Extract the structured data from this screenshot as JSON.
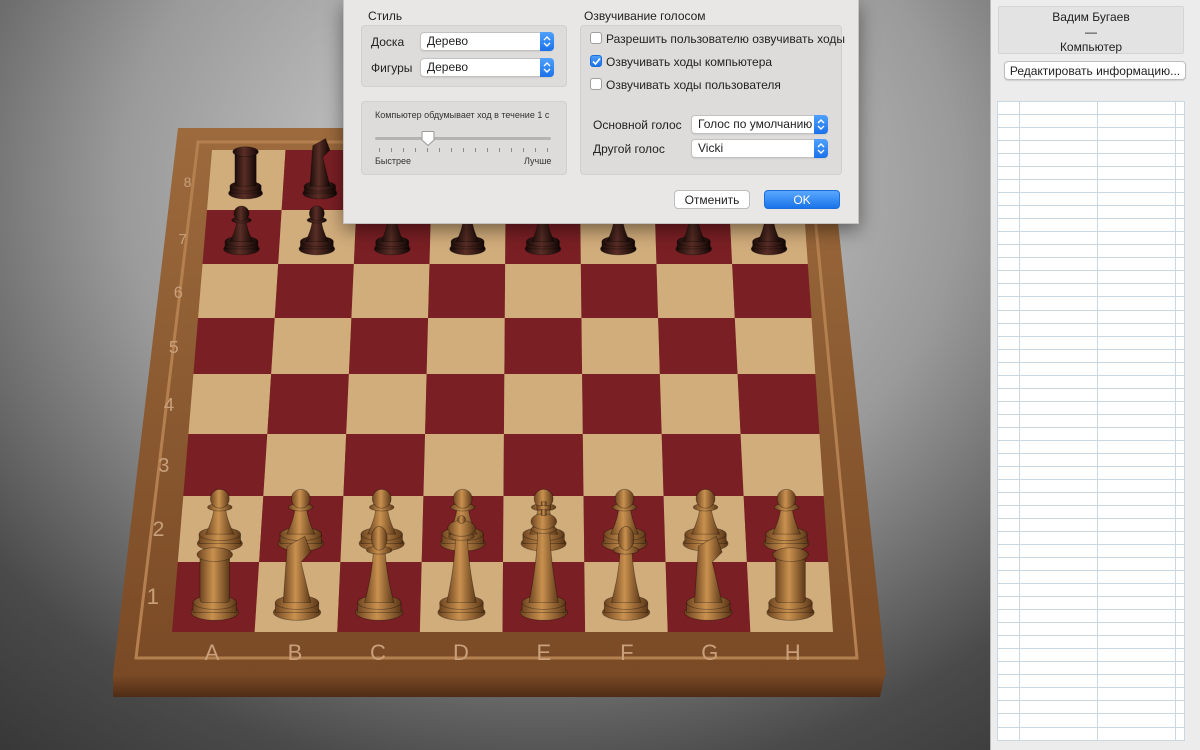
{
  "board": {
    "rank_labels": [
      "8",
      "7",
      "6",
      "5",
      "4",
      "3",
      "2",
      "1"
    ],
    "file_labels": [
      "A",
      "B",
      "C",
      "D",
      "E",
      "F",
      "G",
      "H"
    ],
    "colors": {
      "light": "#d2ad7c",
      "dark": "#7a1f24",
      "frame": "#8b5a33",
      "white_piece": "#a9743d",
      "black_piece": "#3a1d18"
    }
  },
  "pieces": [
    {
      "type": "rook",
      "color": "black",
      "square": "a8"
    },
    {
      "type": "knight",
      "color": "black",
      "square": "b8"
    },
    {
      "type": "pawn",
      "color": "black",
      "square": "a7"
    },
    {
      "type": "pawn",
      "color": "black",
      "square": "b7"
    },
    {
      "type": "pawn",
      "color": "black",
      "square": "c7"
    },
    {
      "type": "pawn",
      "color": "black",
      "square": "d7"
    },
    {
      "type": "pawn",
      "color": "black",
      "square": "e7"
    },
    {
      "type": "pawn",
      "color": "black",
      "square": "f7"
    },
    {
      "type": "pawn",
      "color": "black",
      "square": "g7"
    },
    {
      "type": "pawn",
      "color": "black",
      "square": "h7"
    },
    {
      "type": "pawn",
      "color": "white",
      "square": "a2"
    },
    {
      "type": "pawn",
      "color": "white",
      "square": "b2"
    },
    {
      "type": "pawn",
      "color": "white",
      "square": "c2"
    },
    {
      "type": "pawn",
      "color": "white",
      "square": "d2"
    },
    {
      "type": "pawn",
      "color": "white",
      "square": "e2"
    },
    {
      "type": "pawn",
      "color": "white",
      "square": "f2"
    },
    {
      "type": "pawn",
      "color": "white",
      "square": "g2"
    },
    {
      "type": "pawn",
      "color": "white",
      "square": "h2"
    },
    {
      "type": "rook",
      "color": "white",
      "square": "a1"
    },
    {
      "type": "knight",
      "color": "white",
      "square": "b1"
    },
    {
      "type": "bishop",
      "color": "white",
      "square": "c1"
    },
    {
      "type": "queen",
      "color": "white",
      "square": "d1"
    },
    {
      "type": "king",
      "color": "white",
      "square": "e1"
    },
    {
      "type": "bishop",
      "color": "white",
      "square": "f1"
    },
    {
      "type": "knight",
      "color": "white",
      "square": "g1"
    },
    {
      "type": "rook",
      "color": "white",
      "square": "h1"
    }
  ],
  "side_panel": {
    "white_player": "Вадим Бугаев",
    "separator": "—",
    "black_player": "Компьютер",
    "edit_button": "Редактировать информацию..."
  },
  "prefs": {
    "style_title": "Стиль",
    "board_label": "Доска",
    "board_value": "Дерево",
    "pieces_label": "Фигуры",
    "pieces_value": "Дерево",
    "think_label": "Компьютер обдумывает ход в течение 1 с",
    "think_slider_level": 0.3,
    "faster_label": "Быстрее",
    "better_label": "Лучше",
    "voice_title": "Озвучивание голосом",
    "opt_user_speak": "Разрешить пользователю озвучивать ходы",
    "opt_user_speak_checked": false,
    "opt_computer_moves": "Озвучивать ходы компьютера",
    "opt_computer_moves_checked": true,
    "opt_user_moves": "Озвучивать ходы пользователя",
    "opt_user_moves_checked": false,
    "main_voice_label": "Основной голос",
    "main_voice_value": "Голос по умолчанию",
    "other_voice_label": "Другой голос",
    "other_voice_value": "Vicki",
    "cancel_button": "Отменить",
    "ok_button": "OK",
    "accent": "#1a73e8"
  }
}
